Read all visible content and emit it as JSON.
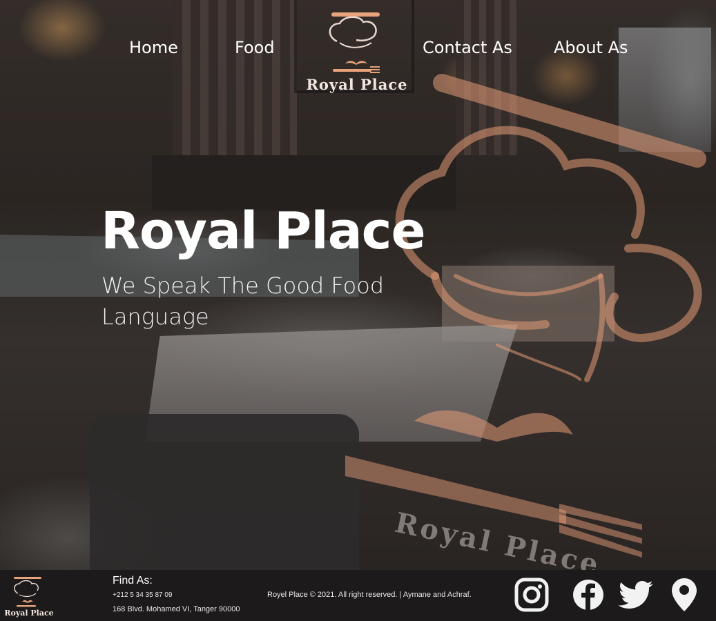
{
  "nav": {
    "links": [
      "Home",
      "Food",
      "Contact As",
      "About As"
    ],
    "logo_text": "Royal Place"
  },
  "hero": {
    "title": "Royal Place",
    "tagline": "We Speak The Good Food Language",
    "watermark_text": "Royal Place"
  },
  "footer": {
    "logo_text": "Royal Place",
    "find_title": "Find As:",
    "phone": "+212 5 34 35 87 09",
    "address": "168 Blvd. Mohamed VI, Tanger 90000",
    "copyright": "Royel Place  © 2021. All right reserved. | Aymane and Achraf.",
    "social_icons": [
      "instagram-icon",
      "facebook-icon",
      "twitter-icon",
      "location-pin-icon"
    ]
  },
  "colors": {
    "accent": "#e8a27c",
    "footer_bg": "#1c1a1a",
    "text": "#ffffff"
  }
}
